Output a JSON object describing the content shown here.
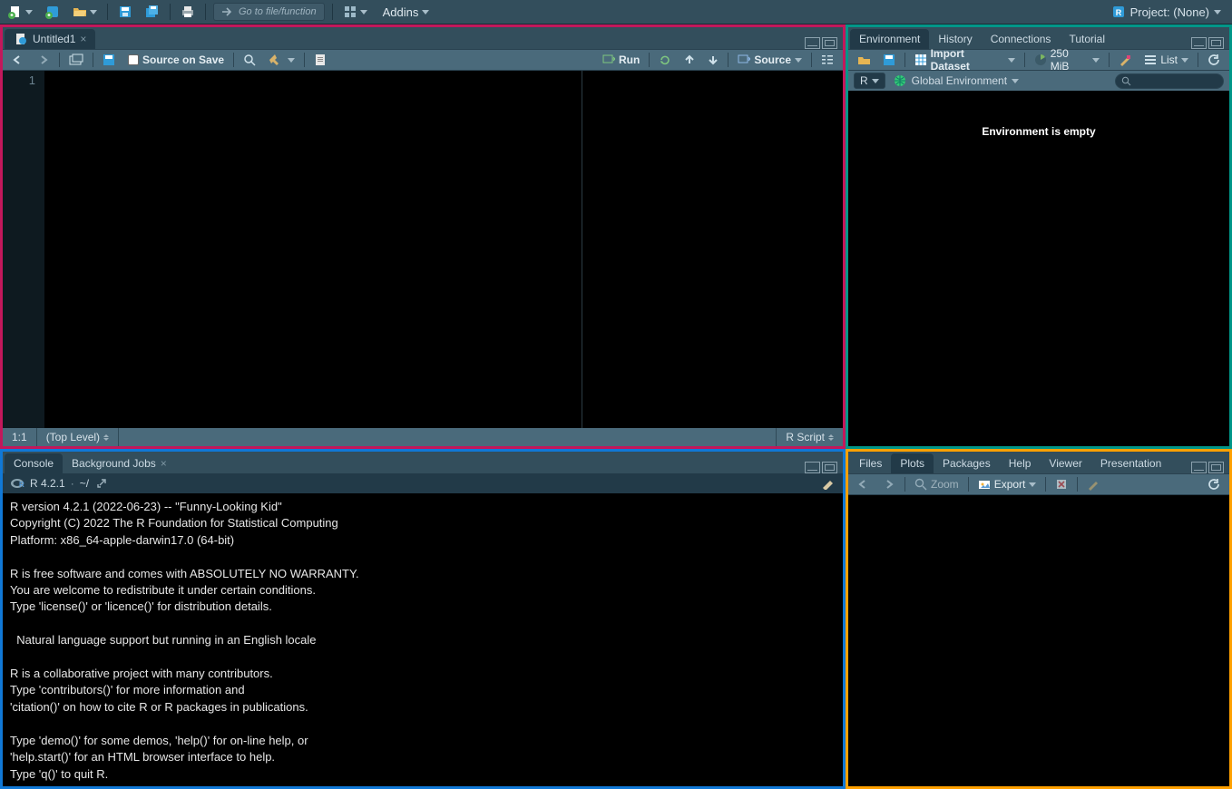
{
  "toolbar": {
    "goto_placeholder": "Go to file/function",
    "addins_label": "Addins",
    "project_label": "Project: (None)"
  },
  "source": {
    "tab_title": "Untitled1",
    "source_on_save": "Source on Save",
    "run_label": "Run",
    "source_label": "Source",
    "line_number": "1",
    "status_pos": "1:1",
    "status_scope": "(Top Level)",
    "status_type": "R Script"
  },
  "console": {
    "tabs": [
      "Console",
      "Background Jobs"
    ],
    "version": "R 4.2.1",
    "path": "~/",
    "output": "R version 4.2.1 (2022-06-23) -- \"Funny-Looking Kid\"\nCopyright (C) 2022 The R Foundation for Statistical Computing\nPlatform: x86_64-apple-darwin17.0 (64-bit)\n\nR is free software and comes with ABSOLUTELY NO WARRANTY.\nYou are welcome to redistribute it under certain conditions.\nType 'license()' or 'licence()' for distribution details.\n\n  Natural language support but running in an English locale\n\nR is a collaborative project with many contributors.\nType 'contributors()' for more information and\n'citation()' on how to cite R or R packages in publications.\n\nType 'demo()' for some demos, 'help()' for on-line help, or\n'help.start()' for an HTML browser interface to help.\nType 'q()' to quit R.\n"
  },
  "environment": {
    "tabs": [
      "Environment",
      "History",
      "Connections",
      "Tutorial"
    ],
    "import_label": "Import Dataset",
    "memory": "250 MiB",
    "view_label": "List",
    "scope_lang": "R",
    "scope_env": "Global Environment",
    "empty_msg": "Environment is empty"
  },
  "plots": {
    "tabs": [
      "Files",
      "Plots",
      "Packages",
      "Help",
      "Viewer",
      "Presentation"
    ],
    "zoom_label": "Zoom",
    "export_label": "Export"
  }
}
